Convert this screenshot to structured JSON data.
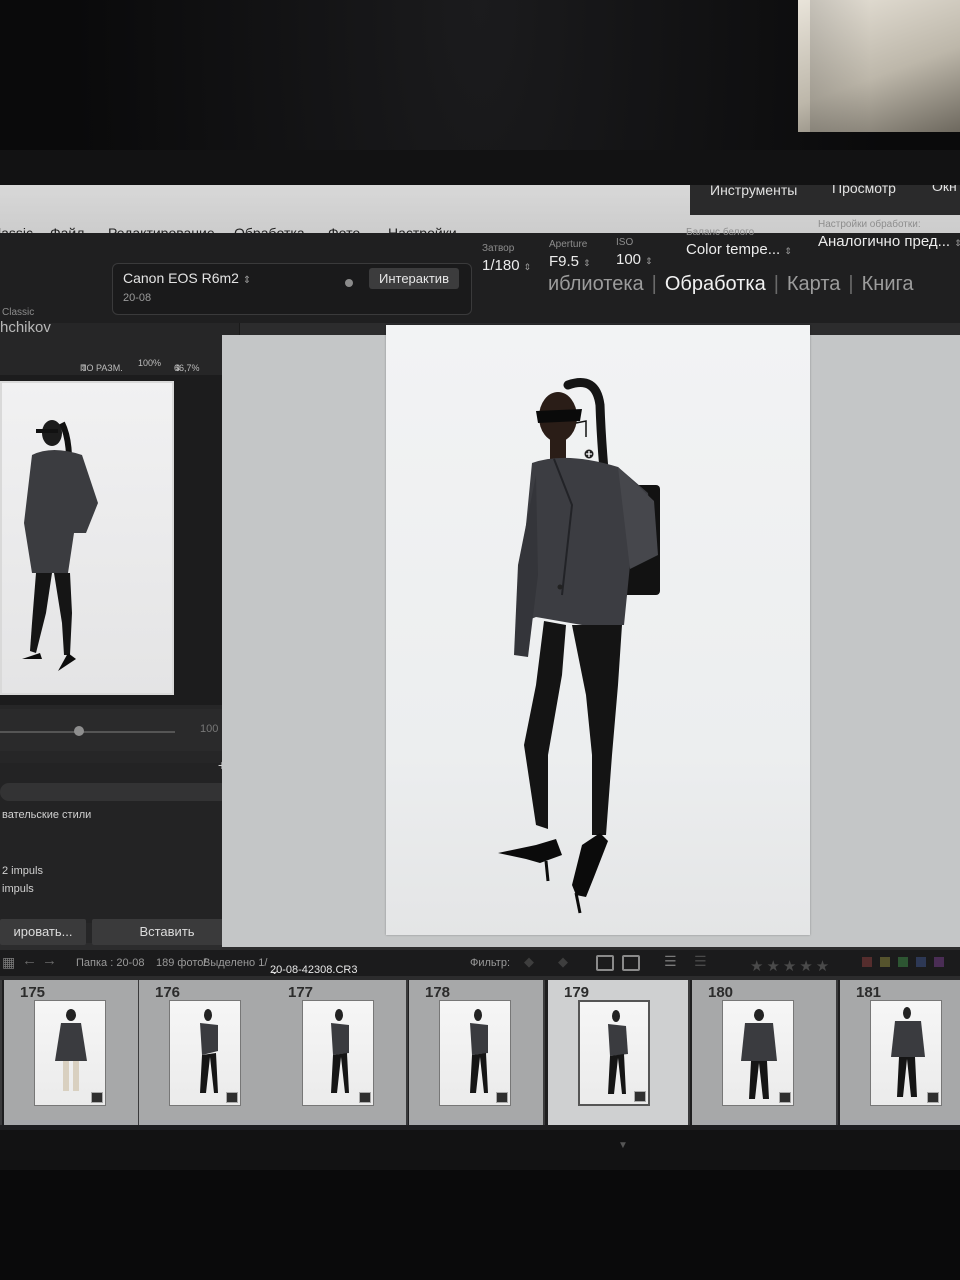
{
  "menu": {
    "items": [
      "lassic",
      "Файл",
      "Редактирование",
      "Обработка",
      "Фото",
      "Настройки"
    ],
    "right_tabs": [
      "Инструменты",
      "Просмотр",
      "Окн"
    ]
  },
  "camera": {
    "name": "Canon EOS R6m2",
    "name_arrow": "⇕",
    "date": "20-08",
    "interactive_label": "Интерактив",
    "params": [
      {
        "label": "Затвор",
        "value": "1/180"
      },
      {
        "label": "Aperture",
        "value": "F9.5"
      },
      {
        "label": "ISO",
        "value": "100"
      },
      {
        "label": "Баланс белого",
        "value": "Color tempe..."
      },
      {
        "label": "Настройки обработки:",
        "value": "Аналогично пред..."
      }
    ]
  },
  "modules": {
    "library": "иблиотека",
    "develop": "Обработка",
    "map": "Карта",
    "book": "Книга",
    "separator": "|"
  },
  "left_panel": {
    "brand_small": "Classic",
    "brand": "hchikov",
    "navigator": {
      "fit": "ПО РАЗМ.",
      "zoom1": "100%",
      "zoom2": "66,7%"
    },
    "slider_value": "100",
    "presets_plus": "+.",
    "presets": [
      "вательские стили",
      "2 impuls",
      "impuls"
    ],
    "copy_button": "ировать...",
    "paste_button": "Вставить"
  },
  "filmstrip_header": {
    "folder": "Папка : 20-08",
    "count": "189 фото/",
    "selected": "Выделено 1/",
    "file": "20-08-42308.CR3",
    "file_arrow": "⌄",
    "filter_label": "Фильтр:",
    "stars": "★★★★★"
  },
  "filmstrip": [
    {
      "number": "175"
    },
    {
      "number": "176"
    },
    {
      "number": "177"
    },
    {
      "number": "178"
    },
    {
      "number": "179",
      "selected": true
    },
    {
      "number": "180"
    },
    {
      "number": "181"
    }
  ],
  "colors": {
    "panel_dark": "#262627",
    "viewer_bg": "#c4c6c7",
    "menu_light": "#d0d0d0",
    "selection": "#cfd0d1"
  },
  "icons": [
    "zoom-cursor-icon",
    "grid-icon",
    "prev-arrow-icon",
    "next-arrow-icon",
    "filter-icons",
    "plus-icon"
  ]
}
